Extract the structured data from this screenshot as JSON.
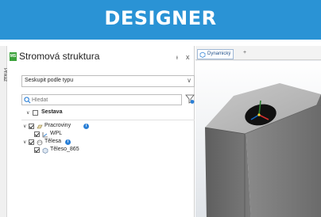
{
  "banner": {
    "title": "DESIGNER"
  },
  "left_strip": {
    "label": "Příkaz"
  },
  "panel": {
    "logo_text": "MS",
    "title": "Stromová struktura",
    "pin_glyph": "ᵻ",
    "close_glyph": "x",
    "group_select": {
      "value": "Seskupit podle typu"
    },
    "search": {
      "placeholder": "Hledat"
    },
    "tree": {
      "header": "Sestava",
      "items": [
        {
          "label": "Pracroviny",
          "icon": "workplane-icon",
          "has_info": true
        },
        {
          "label": "WPL",
          "icon": "wpl-icon",
          "has_info": false
        },
        {
          "label": "Tělesa",
          "icon": "body-icon",
          "has_info": true
        },
        {
          "label": "Těleso_865",
          "icon": "solid-icon",
          "has_info": false
        }
      ]
    }
  },
  "viewport": {
    "tab_label": "Dynamický",
    "add_tab_glyph": "+"
  },
  "colors": {
    "banner": "#2a93d5",
    "logo": "#3aa23a",
    "info": "#2a7fd6"
  }
}
